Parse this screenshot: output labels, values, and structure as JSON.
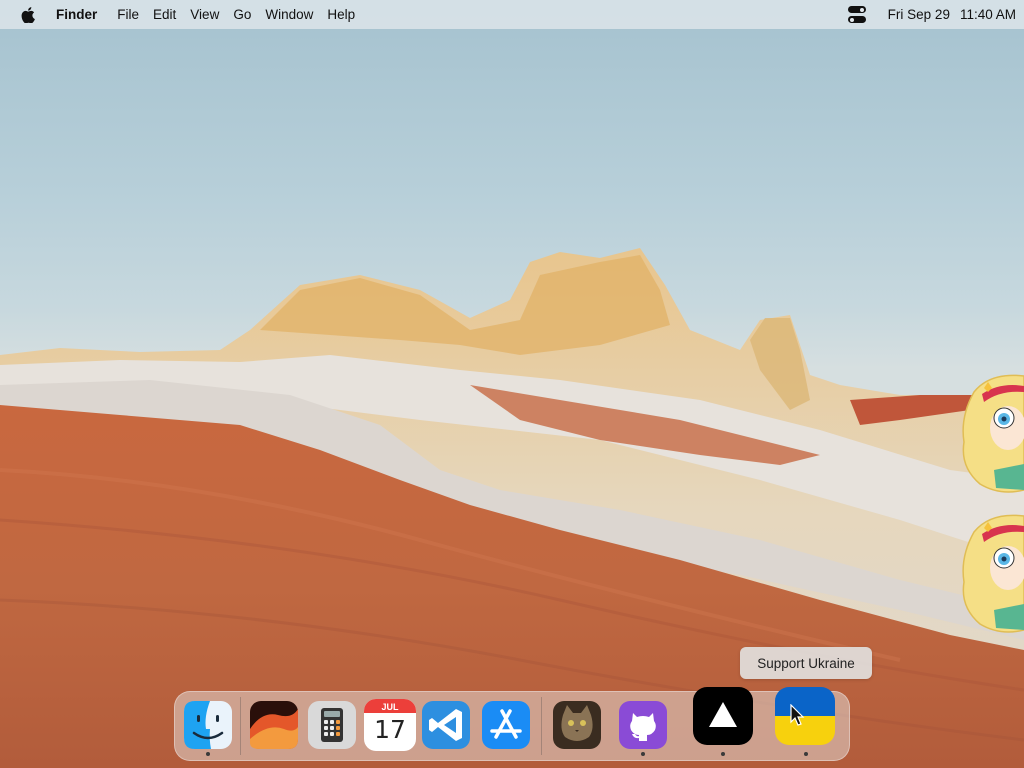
{
  "menubar": {
    "app_name": "Finder",
    "menus": [
      "File",
      "Edit",
      "View",
      "Go",
      "Window",
      "Help"
    ],
    "date": "Fri Sep 29",
    "time": "11:40 AM",
    "icons": [
      "apple-logo-icon",
      "control-center-icon"
    ]
  },
  "tooltip": {
    "text": "Support Ukraine"
  },
  "dock": {
    "apps": [
      {
        "name": "Finder",
        "icon": "finder-icon",
        "running": true
      },
      {
        "name": "macOS Ventura",
        "icon": "ventura-icon",
        "running": false
      },
      {
        "name": "Calculator",
        "icon": "calculator-icon",
        "running": false
      },
      {
        "name": "Calendar",
        "icon": "calendar-icon",
        "running": false,
        "month": "JUL",
        "day": "17"
      },
      {
        "name": "Visual Studio Code",
        "icon": "vscode-icon",
        "running": false
      },
      {
        "name": "App Store",
        "icon": "app-store-icon",
        "running": false
      },
      {
        "name": "Cat",
        "icon": "cat-photo-icon",
        "running": false
      },
      {
        "name": "GitHub Desktop",
        "icon": "github-icon",
        "running": true
      },
      {
        "name": "Vercel",
        "icon": "vercel-triangle-icon",
        "running": true
      },
      {
        "name": "Support Ukraine",
        "icon": "ukraine-flag-icon",
        "running": true
      }
    ]
  },
  "colors": {
    "ukraine_blue": "#0057b7",
    "ukraine_yellow": "#ffd700",
    "github_purple": "#8a4bd6",
    "vscode_blue": "#1e8ad6",
    "app_store_blue": "#1a8cf5"
  }
}
